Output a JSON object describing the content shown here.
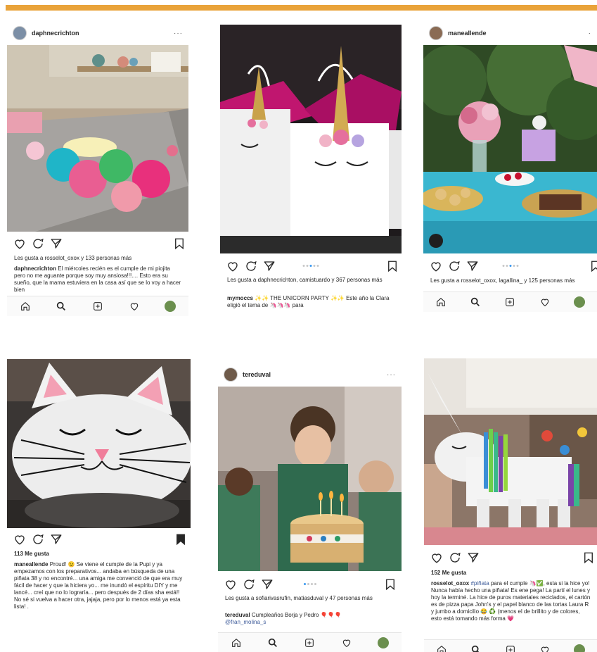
{
  "colors": {
    "accent_bar": "#e9a33a",
    "link_blue": "#3b5998",
    "dot_active": "#3897f0"
  },
  "cards": [
    {
      "username": "daphnecrichton",
      "more": "···",
      "likes": "Les gusta a rosselot_oxox y 133 personas más",
      "caption_user": "daphnecrichton",
      "caption": "El miércoles recién es el cumple de mi piojita pero no me aguante porque soy muy ansiosa!!!.... Esto era su sueño, que la mama estuviera en la casa así que se lo voy a hacer bien"
    },
    {
      "likes": "Les gusta a daphnecrichton, camistuardo y 367 personas más",
      "caption_user": "mymoccs",
      "caption": "✨✨ THE UNICORN PARTY ✨✨ Este año la Clara eligió el tema de 🦄🦄🦄 para"
    },
    {
      "username": "maneallende",
      "more": "·",
      "likes": "Les gusta a rosselot_oxox, lagallina_ y 125 personas más"
    },
    {
      "likes": "113 Me gusta",
      "caption_user": "maneallende",
      "caption": "Proud! 😉 Se viene el cumple de la Pupi y ya empezamos con los preparativos... andaba en búsqueda de una piñata 38 y no encontré... una amiga me convenció de que era muy fácil de hacer y que la hiciera yo... me inundó el espíritu DIY y me lancé... creí que no lo lograría... pero después de 2 días sha está!! No sé si vuelva a hacer otra, jajaja, pero por lo menos está ya esta lista! ."
    },
    {
      "username": "tereduval",
      "more": "···",
      "likes": "Les gusta a sofiarivasrufin, matiasduval y 47 personas más",
      "caption_user": "tereduval",
      "caption": "Cumpleaños Borja y Pedro 🎈🎈🎈",
      "mention": "@fran_molina_s"
    },
    {
      "likes": "152 Me gusta",
      "caption_user": "rosselot_oxox",
      "hashtag": "#piñata",
      "caption": "para el cumple 🦄✅, esta si la hice yo! Nunca había hecho una piñata! Es ene pega! La partí el lunes y hoy la terminé. La hice de puros materiales reciclados, el cartón es de pizza papa John's y el papel blanco de las tortas Laura R y jumbo a domicilio 😂 ♻️ (menos el de brillito y de colores, esto está tomando más forma 💗"
    }
  ]
}
